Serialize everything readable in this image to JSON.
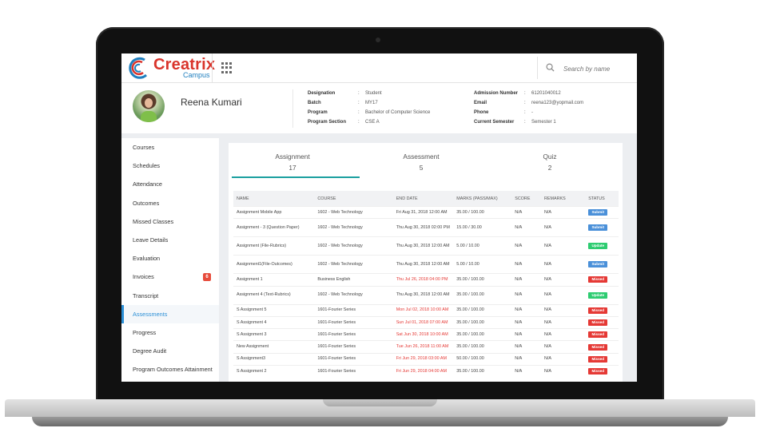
{
  "header": {
    "logo_title": "Creatrix",
    "logo_subtitle": "Campus",
    "search_placeholder": "Search by name"
  },
  "profile": {
    "name": "Reena Kumari",
    "fields_left": [
      {
        "label": "Designation",
        "value": "Student"
      },
      {
        "label": "Batch",
        "value": "MY17"
      },
      {
        "label": "Program",
        "value": "Bachelor of Computer Science"
      },
      {
        "label": "Program Section",
        "value": "CSE A"
      }
    ],
    "fields_right": [
      {
        "label": "Admission Number",
        "value": "61201040012"
      },
      {
        "label": "Email",
        "value": "reena123@yopmail.com"
      },
      {
        "label": "Phone",
        "value": "-"
      },
      {
        "label": "Current Semester",
        "value": "Semester 1"
      }
    ],
    "separator": ":"
  },
  "sidebar": {
    "items": [
      {
        "label": "Courses"
      },
      {
        "label": "Schedules"
      },
      {
        "label": "Attendance"
      },
      {
        "label": "Outcomes"
      },
      {
        "label": "Missed Classes"
      },
      {
        "label": "Leave Details"
      },
      {
        "label": "Evaluation"
      },
      {
        "label": "Invoices",
        "badge": "6"
      },
      {
        "label": "Transcript"
      },
      {
        "label": "Assessments",
        "active": true
      },
      {
        "label": "Progress"
      },
      {
        "label": "Degree Audit"
      },
      {
        "label": "Program Outcomes Attainment"
      }
    ]
  },
  "tabs": [
    {
      "label": "Assignment",
      "count": "17",
      "active": true
    },
    {
      "label": "Assessment",
      "count": "5"
    },
    {
      "label": "Quiz",
      "count": "2"
    }
  ],
  "table": {
    "headers": [
      "NAME",
      "COURSE",
      "END DATE",
      "MARKS (PASS/MAX)",
      "SCORE",
      "REMARKS",
      "STATUS"
    ],
    "rows": [
      {
        "name": "Assignment Mobile App",
        "course": "1602 - Web Technology",
        "end_date": "Fri Aug 31, 2018 12:00 AM",
        "marks": "35.00 / 100.00",
        "score": "N/A",
        "remarks": "N/A",
        "status": "Submit",
        "overdue": false
      },
      {
        "name": "Assignment - 3 (Question Paper)",
        "course": "1602 - Web Technology",
        "end_date": "Thu Aug 30, 2018 02:00 PM",
        "marks": "15.00 / 30.00",
        "score": "N/A",
        "remarks": "N/A",
        "status": "Submit",
        "overdue": false
      },
      {
        "name": "Assignment (File-Rubrics)",
        "course": "1602 - Web Technology",
        "end_date": "Thu Aug 30, 2018 12:00 AM",
        "marks": "5.00 / 10.00",
        "score": "N/A",
        "remarks": "N/A",
        "status": "Update",
        "overdue": false
      },
      {
        "name": "Assignment1(File-Outcomes)",
        "course": "1602 - Web Technology",
        "end_date": "Thu Aug 30, 2018 12:00 AM",
        "marks": "5.00 / 10.00",
        "score": "N/A",
        "remarks": "N/A",
        "status": "Submit",
        "overdue": false
      },
      {
        "name": "Assignment 1",
        "course": "Business English",
        "end_date": "Thu Jul 26, 2018 04:00 PM",
        "marks": "35.00 / 100.00",
        "score": "N/A",
        "remarks": "N/A",
        "status": "Missed",
        "overdue": true
      },
      {
        "name": "Assignment 4 (Text-Rubrics)",
        "course": "1602 - Web Technology",
        "end_date": "Thu Aug 30, 2018 12:00 AM",
        "marks": "35.00 / 100.00",
        "score": "N/A",
        "remarks": "N/A",
        "status": "Update",
        "overdue": false
      },
      {
        "name": "S Assignment 5",
        "course": "1601-Fourier Series",
        "end_date": "Mon Jul 02, 2018 10:00 AM",
        "marks": "35.00 / 100.00",
        "score": "N/A",
        "remarks": "N/A",
        "status": "Missed",
        "overdue": true
      },
      {
        "name": "S Assignment 4",
        "course": "1601-Fourier Series",
        "end_date": "Sun Jul 01, 2018 07:00 AM",
        "marks": "35.00 / 100.00",
        "score": "N/A",
        "remarks": "N/A",
        "status": "Missed",
        "overdue": true
      },
      {
        "name": "S Assignment 3",
        "course": "1601-Fourier Series",
        "end_date": "Sat Jun 30, 2018 10:00 AM",
        "marks": "35.00 / 100.00",
        "score": "N/A",
        "remarks": "N/A",
        "status": "Missed",
        "overdue": true
      },
      {
        "name": "New Assignment",
        "course": "1601-Fourier Series",
        "end_date": "Tue Jun 26, 2018 11:00 AM",
        "marks": "35.00 / 100.00",
        "score": "N/A",
        "remarks": "N/A",
        "status": "Missed",
        "overdue": true
      },
      {
        "name": "S Assignment3",
        "course": "1601-Fourier Series",
        "end_date": "Fri Jun 29, 2018 03:00 AM",
        "marks": "50.00 / 100.00",
        "score": "N/A",
        "remarks": "N/A",
        "status": "Missed",
        "overdue": true
      },
      {
        "name": "S Assignment 2",
        "course": "1601-Fourier Series",
        "end_date": "Fri Jun 29, 2018 04:00 AM",
        "marks": "35.00 / 100.00",
        "score": "N/A",
        "remarks": "N/A",
        "status": "Missed",
        "overdue": true
      }
    ]
  },
  "colors": {
    "accent": "#1aa0a0",
    "link": "#2b8fd6",
    "submit": "#4a90d9",
    "update": "#2ecc71",
    "missed": "#e53935",
    "brand": "#d9342b"
  }
}
